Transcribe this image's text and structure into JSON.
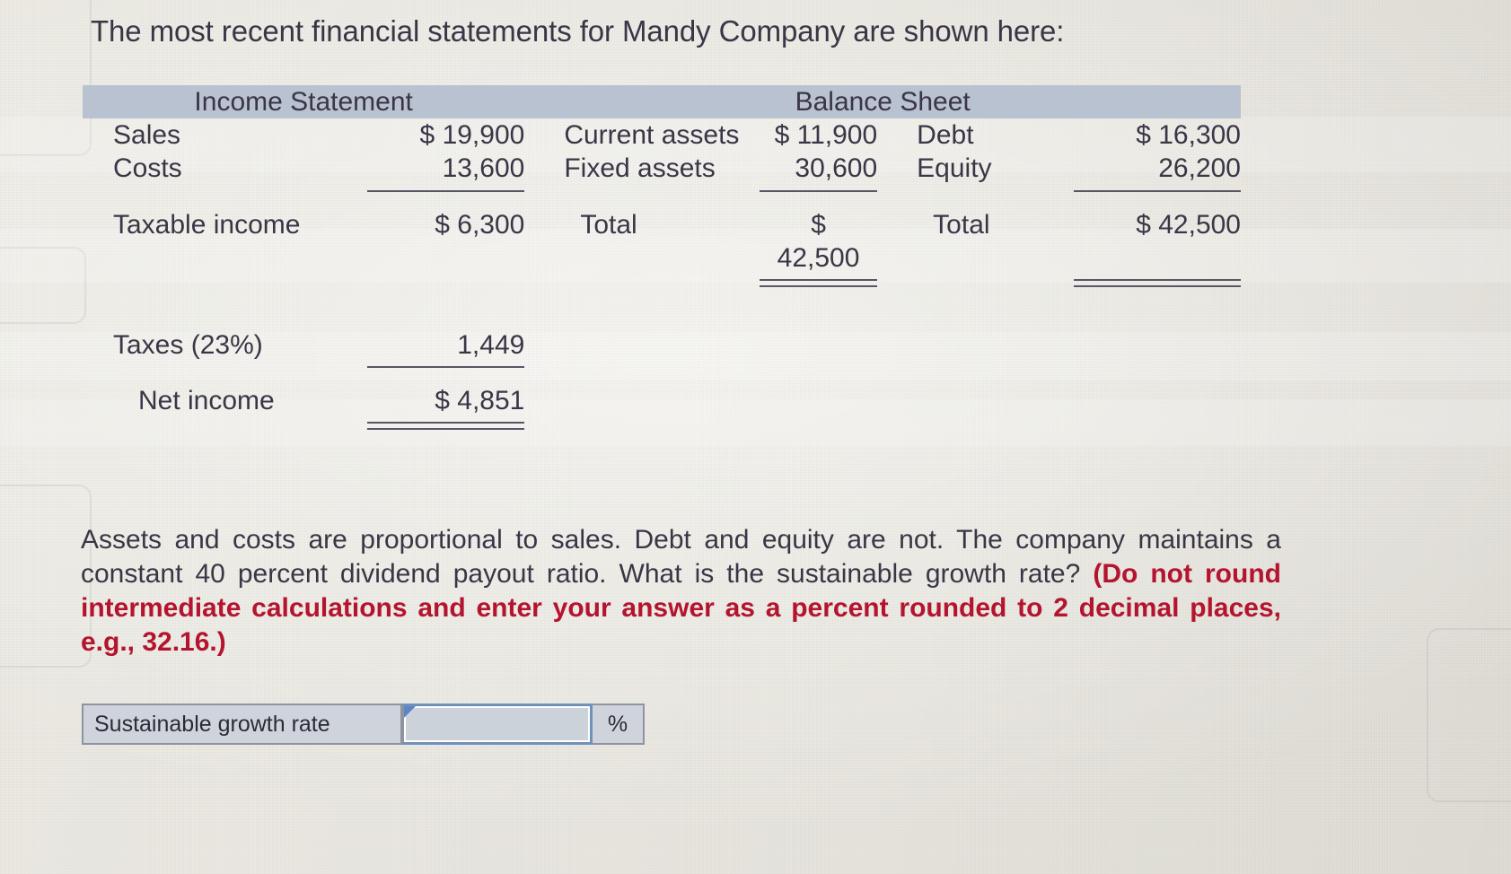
{
  "intro": "The most recent financial statements for Mandy Company are shown here:",
  "statements": {
    "income_statement": {
      "title": "Income Statement",
      "rows": [
        {
          "label": "Sales",
          "value": "$ 19,900"
        },
        {
          "label": "Costs",
          "value": "13,600"
        },
        {
          "label": "Taxable income",
          "value": "$ 6,300"
        },
        {
          "label": "Taxes (23%)",
          "value": "1,449"
        },
        {
          "label": "Net income",
          "value": "$ 4,851"
        }
      ]
    },
    "balance_sheet": {
      "title": "Balance Sheet",
      "assets": [
        {
          "label": "Current assets",
          "value": "$ 11,900"
        },
        {
          "label": "Fixed assets",
          "value": "30,600"
        }
      ],
      "assets_total": {
        "label": "Total",
        "currency": "$",
        "amount": "42,500",
        "value": "$ 42,500"
      },
      "liabilities": [
        {
          "label": "Debt",
          "value": "$ 16,300"
        },
        {
          "label": "Equity",
          "value": "26,200"
        }
      ],
      "liabilities_total": {
        "label": "Total",
        "value": "$ 42,500"
      }
    }
  },
  "question": {
    "body": "Assets and costs are proportional to sales. Debt and equity are not. The company maintains a constant 40 percent dividend payout ratio. What is the sustainable growth rate? ",
    "instruction": "(Do not round intermediate calculations and enter your answer as a percent rounded to 2 decimal places, e.g., 32.16.)"
  },
  "answer": {
    "label": "Sustainable growth rate",
    "value": "",
    "placeholder": "",
    "unit": "%"
  },
  "colors": {
    "header_band": "#b9c2d0",
    "instruction_red": "#b4142e",
    "field_blue_border": "#6f91bb",
    "focus_marker": "#5b87c4",
    "page_background": "#e8e6df",
    "text": "#3b3546"
  }
}
